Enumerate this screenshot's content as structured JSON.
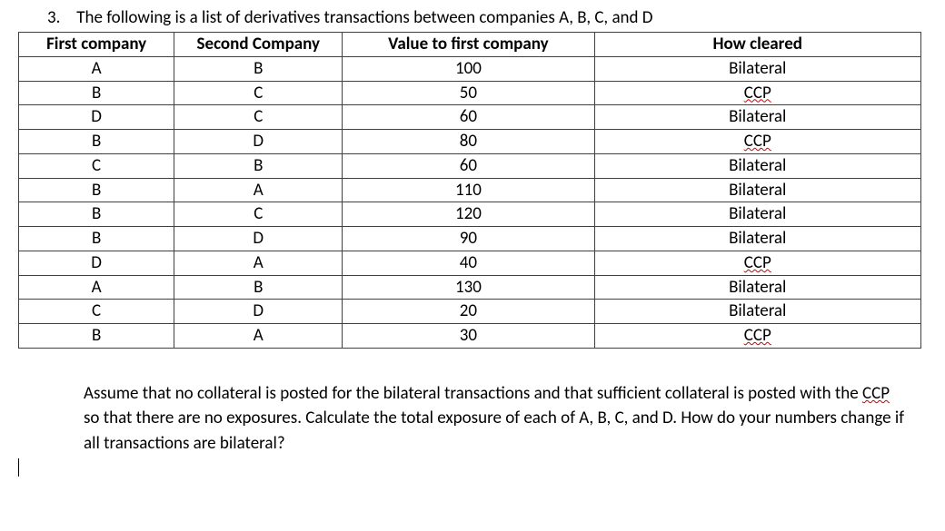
{
  "question": {
    "number": "3.",
    "text": "The following is a list of derivatives transactions between companies A, B, C, and D"
  },
  "table": {
    "headers": {
      "col1": "First company",
      "col2": "Second Company",
      "col3": "Value to first company",
      "col4": "How cleared"
    },
    "rows": [
      {
        "c1": "A",
        "c2": "B",
        "c3": "100",
        "c4": "Bilateral",
        "spell": false
      },
      {
        "c1": "B",
        "c2": "C",
        "c3": "50",
        "c4": "CCP",
        "spell": true
      },
      {
        "c1": "D",
        "c2": "C",
        "c3": "60",
        "c4": "Bilateral",
        "spell": false
      },
      {
        "c1": "B",
        "c2": "D",
        "c3": "80",
        "c4": "CCP",
        "spell": true
      },
      {
        "c1": "C",
        "c2": "B",
        "c3": "60",
        "c4": "Bilateral",
        "spell": false
      },
      {
        "c1": "B",
        "c2": "A",
        "c3": "110",
        "c4": "Bilateral",
        "spell": false
      },
      {
        "c1": "B",
        "c2": "C",
        "c3": "120",
        "c4": "Bilateral",
        "spell": false
      },
      {
        "c1": "B",
        "c2": "D",
        "c3": "90",
        "c4": "Bilateral",
        "spell": false
      },
      {
        "c1": "D",
        "c2": "A",
        "c3": "40",
        "c4": "CCP",
        "spell": true
      },
      {
        "c1": "A",
        "c2": "B",
        "c3": "130",
        "c4": "Bilateral",
        "spell": false
      },
      {
        "c1": "C",
        "c2": "D",
        "c3": "20",
        "c4": "Bilateral",
        "spell": false
      },
      {
        "c1": "B",
        "c2": "A",
        "c3": "30",
        "c4": "CCP",
        "spell": true
      }
    ]
  },
  "followup": {
    "part1": "Assume that no collateral is posted for the bilateral transactions and that sufficient collateral is posted with the ",
    "ccp": "CCP",
    "part2": " so that there are no exposures. Calculate the total exposure of each of A, B, C, and D. How do your numbers change if all transactions are bilateral?"
  }
}
